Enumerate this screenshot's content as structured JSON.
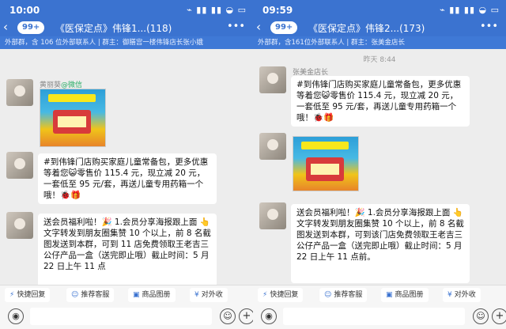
{
  "left": {
    "status_time": "10:00",
    "status_icons": "⌁ ▮▮ ▮▮ ◒ ▭",
    "badge": "99+",
    "title": "《医保定点》伟锋1...(118)",
    "subtitle": "外部群，含 106 位外部联系人 | 群主：御膳宫一楼伟锋店长张小娥",
    "messages": {
      "m1_sender": "黄丽葵",
      "m1_via": "@微信",
      "m2_text": "#到伟锋门店购买家庭儿童常备包，更多优惠等着您😺零售价 115.4 元，现立减 20 元，一套低至 95 元/套，再送儿童专用药箱一个哦！🐞🎁",
      "m3_text": "送会员福利啦！🎉 1.会员分享海报跟上面 👆 文字转发到朋友圈集赞 10 个以上，前 8 名截图发送到本群，可到 11 店免费领取王老吉三公仔产品一盒（送完即止哦）截止时间：5 月 22 日上午 11 点"
    },
    "toolbar": {
      "chips": [
        "快捷回复",
        "推荐客服",
        "商品图册",
        "对外收"
      ]
    }
  },
  "right": {
    "status_time": "09:59",
    "status_icons": "⌁ ▮▮ ▮▮ ◒ ▭",
    "badge": "99+",
    "title": "《医保定点》伟锋2...(173)",
    "subtitle": "外部群，含161位外部联系人 | 群主：张美金店长",
    "time_sep": "昨天 8:44",
    "messages": {
      "m1_sender": "张美金店长",
      "m1_text": "#到伟锋门店购买家庭儿童常备包，更多优惠等着您😺零售价 115.4 元，现立减 20 元，一套低至 95 元/套，再送儿童专用药箱一个哦！🐞🎁",
      "m3_text": "送会员福利啦！🎉 1.会员分享海报跟上面 👆 文字转发到朋友圈集赞 10 个以上，前 8 名截图发送到本群，可到该门店免费领取王老吉三公仔产品一盒（送完即止哦）截止时间：5 月 22 日上午 11 点前。"
    },
    "toolbar": {
      "chips": [
        "快捷回复",
        "推荐客服",
        "商品图册",
        "对外收"
      ]
    }
  },
  "icons": {
    "back": "back-arrow-icon",
    "more": "more-icon",
    "voice": "voice-icon",
    "emoji": "emoji-icon",
    "plus": "plus-icon"
  },
  "colors": {
    "header_blue": "#3b73d0",
    "chat_bg": "#ededed",
    "wechat_green": "#2aae67"
  }
}
